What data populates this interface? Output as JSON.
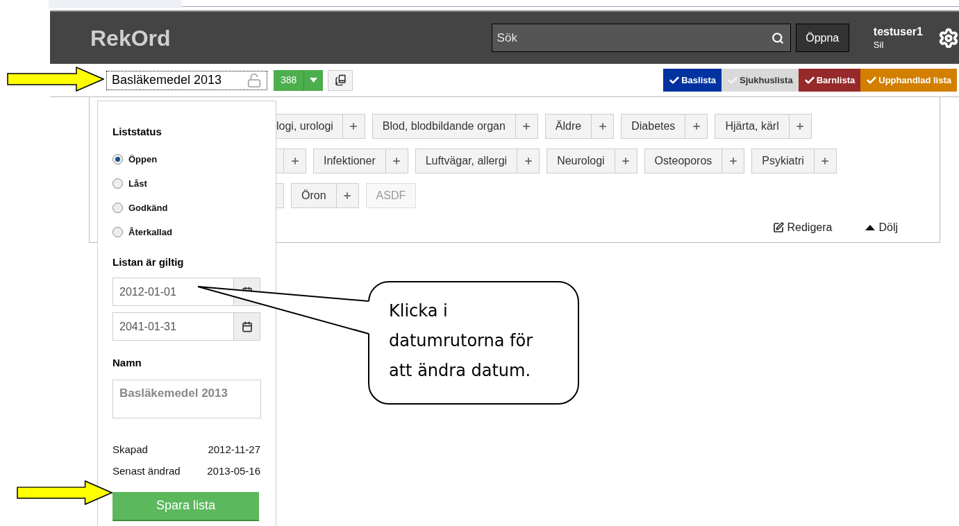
{
  "app": {
    "logo": "RekOrd"
  },
  "search": {
    "placeholder": "Sök"
  },
  "open_button": "Öppna",
  "user": {
    "name": "testuser1",
    "role": "Sil"
  },
  "toolbar": {
    "list_name": "Basläkemedel 2013",
    "locked": false,
    "count": "388"
  },
  "list_tags": [
    {
      "label": "Baslista",
      "color": "#0033a0",
      "selected": true
    },
    {
      "label": "Sjukhuslista",
      "color": "#d9d9d9",
      "selected": false
    },
    {
      "label": "Barnlista",
      "color": "#962a2a",
      "selected": true
    },
    {
      "label": "Upphandlad lista",
      "color": "#d27f00",
      "selected": true
    }
  ],
  "category_rows": [
    {
      "chips": [
        {
          "kind": "partial",
          "label": "logi, urologi",
          "addable": true
        },
        {
          "kind": "chip",
          "label": "Blod, blodbildande organ",
          "addable": true
        },
        {
          "kind": "chip",
          "label": "Äldre",
          "addable": true
        },
        {
          "kind": "chip",
          "label": "Diabetes",
          "addable": true
        },
        {
          "kind": "chip",
          "label": "Hjärta, kärl",
          "addable": true
        }
      ]
    },
    {
      "chips": [
        {
          "kind": "partial",
          "addable": true
        },
        {
          "kind": "chip",
          "label": "Infektioner",
          "addable": true
        },
        {
          "kind": "chip",
          "label": "Luftvägar, allergi",
          "addable": true
        },
        {
          "kind": "chip",
          "label": "Neurologi",
          "addable": true
        },
        {
          "kind": "chip",
          "label": "Osteoporos",
          "addable": true
        },
        {
          "kind": "chip",
          "label": "Psykiatri",
          "addable": true
        }
      ]
    },
    {
      "chips": [
        {
          "kind": "partial",
          "addable": false
        },
        {
          "kind": "chip",
          "label": "Öron",
          "addable": true
        },
        {
          "kind": "chip",
          "label": "ASDF",
          "addable": false,
          "disabled": true
        }
      ]
    }
  ],
  "actions": [
    {
      "kind": "edit",
      "label": "Redigera"
    },
    {
      "kind": "collapse",
      "label": "Dölj"
    }
  ],
  "list_panel": {
    "status_heading": "Liststatus",
    "statuses": [
      {
        "label": "Öppen",
        "selected": true
      },
      {
        "label": "Låst",
        "selected": false
      },
      {
        "label": "Godkänd",
        "selected": false
      },
      {
        "label": "Återkallad",
        "selected": false
      }
    ],
    "validity_heading": "Listan är giltig",
    "valid_from": "2012-01-01",
    "valid_to": "2041-01-31",
    "name_heading": "Namn",
    "name_value": "Basläkemedel 2013",
    "meta": [
      {
        "label": "Skapad",
        "value": "2012-11-27"
      },
      {
        "label": "Senast ändrad",
        "value": "2013-05-16"
      }
    ],
    "save_button": "Spara lista"
  },
  "callout": {
    "text": "Klicka i datumrutorna för att ändra datum."
  }
}
